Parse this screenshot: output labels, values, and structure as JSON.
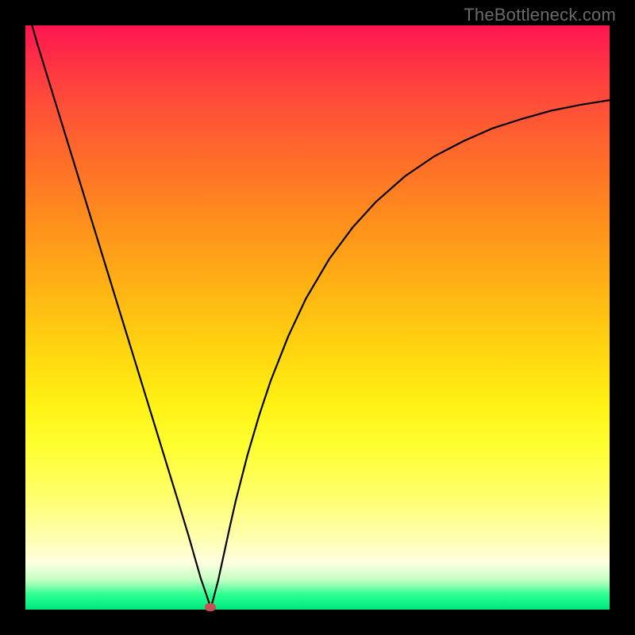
{
  "watermark": "TheBottleneck.com",
  "colors": {
    "frame": "#000000",
    "curve": "#000000",
    "marker": "#c94f54"
  },
  "chart_data": {
    "type": "line",
    "title": "",
    "xlabel": "",
    "ylabel": "",
    "xlim": [
      0,
      100
    ],
    "ylim": [
      0,
      100
    ],
    "grid": false,
    "legend": false,
    "background_gradient_stops": [
      {
        "pos": 0,
        "color": "#ff1452"
      },
      {
        "pos": 0.06,
        "color": "#ff3044"
      },
      {
        "pos": 0.14,
        "color": "#ff5038"
      },
      {
        "pos": 0.24,
        "color": "#ff7028"
      },
      {
        "pos": 0.34,
        "color": "#ff901c"
      },
      {
        "pos": 0.44,
        "color": "#ffb014"
      },
      {
        "pos": 0.54,
        "color": "#ffd010"
      },
      {
        "pos": 0.64,
        "color": "#fff012"
      },
      {
        "pos": 0.72,
        "color": "#ffff30"
      },
      {
        "pos": 0.8,
        "color": "#ffff68"
      },
      {
        "pos": 0.87,
        "color": "#ffffa8"
      },
      {
        "pos": 0.92,
        "color": "#ffffe0"
      },
      {
        "pos": 0.95,
        "color": "#c0ffc0"
      },
      {
        "pos": 0.975,
        "color": "#2aff90"
      },
      {
        "pos": 1.0,
        "color": "#00e680"
      }
    ],
    "series": [
      {
        "name": "bottleneck-curve",
        "x": [
          0,
          2,
          4,
          6,
          8,
          10,
          12,
          14,
          16,
          18,
          20,
          22,
          24,
          26,
          27,
          28,
          29,
          30,
          31,
          31.7,
          32,
          33,
          34,
          35,
          36,
          38,
          40,
          42,
          45,
          48,
          52,
          56,
          60,
          65,
          70,
          75,
          80,
          85,
          90,
          95,
          100
        ],
        "y": [
          104,
          97,
          90.5,
          84,
          77.5,
          71,
          64.5,
          58,
          51.5,
          45,
          38.5,
          32,
          25.5,
          19,
          15.7,
          12.4,
          8.9,
          5.4,
          2.5,
          0.4,
          1.2,
          5.0,
          9.6,
          14.2,
          18.6,
          26.4,
          33.2,
          39.2,
          46.8,
          53.2,
          60.0,
          65.4,
          69.8,
          74.2,
          77.6,
          80.2,
          82.4,
          84.0,
          85.4,
          86.4,
          87.2
        ]
      }
    ],
    "marker": {
      "x": 31.7,
      "y": 0.4
    }
  }
}
